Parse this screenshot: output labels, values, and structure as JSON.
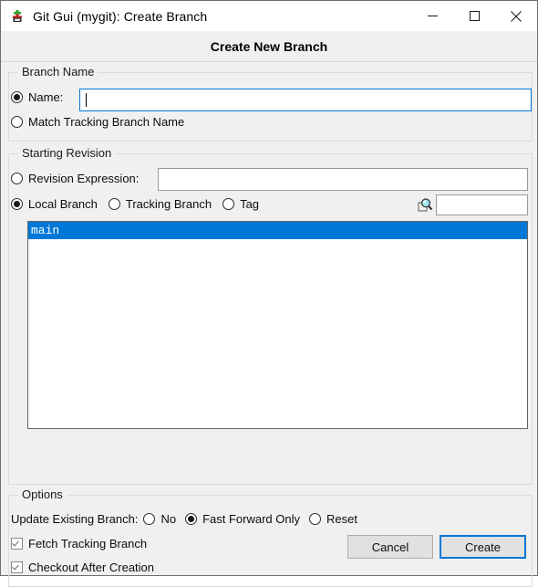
{
  "window": {
    "title": "Git Gui (mygit): Create Branch",
    "app_icon": "git-gui-icon",
    "controls": {
      "minimize": "minimize-icon",
      "maximize": "maximize-icon",
      "close": "close-icon"
    }
  },
  "header": {
    "title": "Create New Branch"
  },
  "branch_name": {
    "group_title": "Branch Name",
    "name_radio_label": "Name:",
    "name_radio_selected": true,
    "name_value": "",
    "match_tracking_label": "Match Tracking Branch Name",
    "match_tracking_selected": false
  },
  "starting_revision": {
    "group_title": "Starting Revision",
    "revision_expression_label": "Revision Expression:",
    "revision_expression_selected": false,
    "revision_expression_value": "",
    "local_branch_label": "Local Branch",
    "local_branch_selected": true,
    "tracking_branch_label": "Tracking Branch",
    "tracking_branch_selected": false,
    "tag_label": "Tag",
    "tag_selected": false,
    "search_icon": "magnifier-icon",
    "search_value": "",
    "branches": [
      {
        "name": "main",
        "selected": true
      }
    ]
  },
  "options": {
    "group_title": "Options",
    "update_existing_label": "Update Existing Branch:",
    "update_no_label": "No",
    "update_no_selected": false,
    "update_fast_forward_label": "Fast Forward Only",
    "update_fast_forward_selected": true,
    "update_reset_label": "Reset",
    "update_reset_selected": false,
    "fetch_tracking_label": "Fetch Tracking Branch",
    "fetch_tracking_checked": true,
    "checkout_after_label": "Checkout After Creation",
    "checkout_after_checked": true
  },
  "footer": {
    "cancel_label": "Cancel",
    "create_label": "Create"
  },
  "colors": {
    "accent": "#0078d7",
    "selection": "#0078d7",
    "window_bg": "#f0f0f0",
    "field_bg": "#ffffff"
  }
}
